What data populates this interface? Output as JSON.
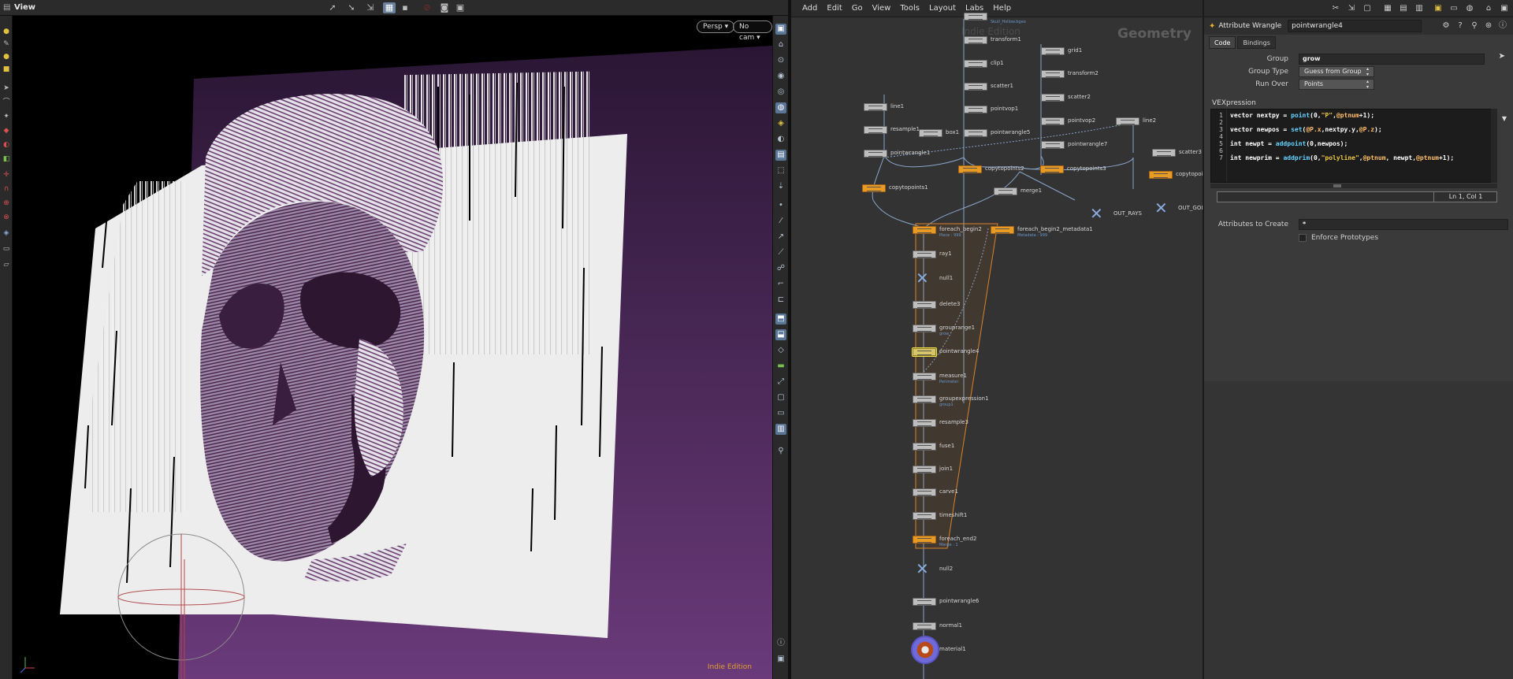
{
  "viewport": {
    "title": "View",
    "camera_mode": "Persp ▾",
    "camera_select": "No cam ▾",
    "edition_label": "Indie Edition"
  },
  "network": {
    "menu": [
      "Add",
      "Edit",
      "Go",
      "View",
      "Tools",
      "Layout",
      "Labs",
      "Help"
    ],
    "context_label": "Geometry",
    "watermark": "Indie Edition",
    "nodes": [
      {
        "id": "file_top",
        "label": "",
        "sub": "Skull_Hollow.bgeo"
      },
      {
        "id": "transform1",
        "label": "transform1",
        "sub": ""
      },
      {
        "id": "clip1",
        "label": "clip1",
        "sub": ""
      },
      {
        "id": "scatter1",
        "label": "scatter1",
        "sub": ""
      },
      {
        "id": "pointvop1",
        "label": "pointvop1",
        "sub": ""
      },
      {
        "id": "pointwrangle5",
        "label": "pointwrangle5",
        "sub": ""
      },
      {
        "id": "grid1",
        "label": "grid1",
        "sub": ""
      },
      {
        "id": "transform2",
        "label": "transform2",
        "sub": ""
      },
      {
        "id": "scatter2",
        "label": "scatter2",
        "sub": ""
      },
      {
        "id": "pointvop2",
        "label": "pointvop2",
        "sub": ""
      },
      {
        "id": "pointwrangle7",
        "label": "pointwrangle7",
        "sub": ""
      },
      {
        "id": "line1",
        "label": "line1",
        "sub": ""
      },
      {
        "id": "resample1",
        "label": "resample1",
        "sub": ""
      },
      {
        "id": "pointwrangle1",
        "label": "pointwrangle1",
        "sub": ""
      },
      {
        "id": "box1",
        "label": "box1",
        "sub": ""
      },
      {
        "id": "line2",
        "label": "line2",
        "sub": ""
      },
      {
        "id": "scatter3",
        "label": "scatter3",
        "sub": ""
      },
      {
        "id": "copytopoints2",
        "label": "copytopoints2",
        "sub": ""
      },
      {
        "id": "copytopoints3",
        "label": "copytopoints3",
        "sub": ""
      },
      {
        "id": "copytopoints_r",
        "label": "copytopoints",
        "sub": ""
      },
      {
        "id": "copytopoints1",
        "label": "copytopoints1",
        "sub": ""
      },
      {
        "id": "merge1",
        "label": "merge1",
        "sub": ""
      },
      {
        "id": "OUT_RAYS",
        "label": "OUT_RAYS",
        "sub": ""
      },
      {
        "id": "OUT_GOLD",
        "label": "OUT_GOLD",
        "sub": ""
      },
      {
        "id": "foreach_begin2",
        "label": "foreach_begin2",
        "sub": "Piece : 999"
      },
      {
        "id": "foreach_begin2_metadata1",
        "label": "foreach_begin2_metadata1",
        "sub": "Metadata : 999"
      },
      {
        "id": "ray1",
        "label": "ray1",
        "sub": ""
      },
      {
        "id": "null1",
        "label": "null1",
        "sub": ""
      },
      {
        "id": "delete3",
        "label": "delete3",
        "sub": ""
      },
      {
        "id": "grouprange1",
        "label": "grouprange1",
        "sub": "grow"
      },
      {
        "id": "pointwrangle4",
        "label": "pointwrangle4",
        "sub": ""
      },
      {
        "id": "measure1",
        "label": "measure1",
        "sub": "Perimeter"
      },
      {
        "id": "groupexpression1",
        "label": "groupexpression1",
        "sub": "group1"
      },
      {
        "id": "resample3",
        "label": "resample3",
        "sub": ""
      },
      {
        "id": "fuse1",
        "label": "fuse1",
        "sub": ""
      },
      {
        "id": "join1",
        "label": "join1",
        "sub": ""
      },
      {
        "id": "carve1",
        "label": "carve1",
        "sub": ""
      },
      {
        "id": "timeshift1",
        "label": "timeshift1",
        "sub": ""
      },
      {
        "id": "foreach_end2",
        "label": "foreach_end2",
        "sub": "Merge : 1"
      },
      {
        "id": "null2",
        "label": "null2",
        "sub": ""
      },
      {
        "id": "pointwrangle6",
        "label": "pointwrangle6",
        "sub": ""
      },
      {
        "id": "normal1",
        "label": "normal1",
        "sub": ""
      },
      {
        "id": "material1",
        "label": "material1",
        "sub": ""
      }
    ]
  },
  "params": {
    "node_type": "Attribute Wrangle",
    "node_name": "pointwrangle4",
    "tabs": [
      "Code",
      "Bindings"
    ],
    "group_label": "Group",
    "group_value": "grow",
    "group_type_label": "Group Type",
    "group_type_value": "Guess from Group",
    "run_over_label": "Run Over",
    "run_over_value": "Points",
    "vexpression_label": "VEXpression",
    "line_numbers": [
      "1",
      "2",
      "3",
      "4",
      "5",
      "6",
      "7"
    ],
    "code": {
      "l1": {
        "a": "vector nextpy = ",
        "fn": "point",
        "b": "(0,",
        "s": "\"P\"",
        "c": ",",
        "at": "@ptnum",
        "d": "+1);"
      },
      "l3": {
        "a": "vector newpos = ",
        "fn": "set",
        "b": "(",
        "at1": "@P.x",
        "c": ",nextpy.y,",
        "at2": "@P.z",
        "d": ");"
      },
      "l5": {
        "a": "int newpt = ",
        "fn": "addpoint",
        "b": "(0,newpos);"
      },
      "l7": {
        "a": "int newprim = ",
        "fn": "addprim",
        "b": "(0,",
        "s": "\"polyline\"",
        "c": ",",
        "at1": "@ptnum",
        "d": ", newpt,",
        "at2": "@ptnum",
        "e": "+1);"
      }
    },
    "cursor_pos": "Ln 1, Col 1",
    "attrs_label": "Attributes to Create",
    "attrs_value": "*",
    "enforce_label": "Enforce Prototypes"
  },
  "colors": {
    "viewport_bg": "#000000",
    "viewport_plane": "#3a2040",
    "mesh": "#e6e6e6",
    "network_bg": "#333333",
    "node_orange": "#e89a22",
    "selected_node": "#d8c66a"
  }
}
